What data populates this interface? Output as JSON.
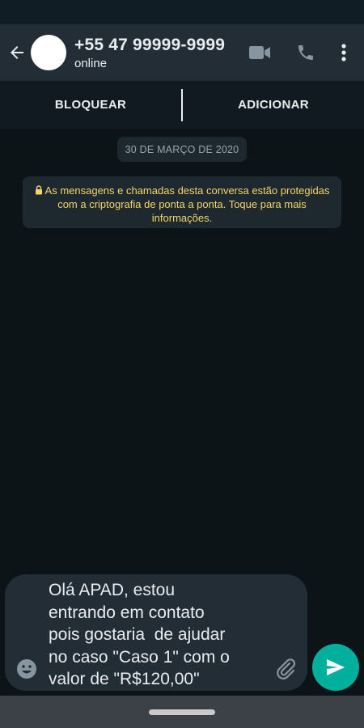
{
  "header": {
    "contact_name": "+55  47 99999-9999",
    "contact_status": "online",
    "icons": [
      "back-arrow-icon",
      "video-call-icon",
      "phone-icon",
      "more-vert-icon"
    ]
  },
  "actions": {
    "block_label": "BLOQUEAR",
    "add_label": "ADICIONAR"
  },
  "chat": {
    "date_label": "30 DE MARÇO DE 2020",
    "encryption_notice": "As mensagens e chamadas desta conversa estão protegidas com a criptografia de ponta a ponta. Toque para mais informações."
  },
  "composer": {
    "text": "Olá APAD, estou\nentrando em contato\npois gostaria  de ajudar\nno caso \"Caso 1\" com o\nvalor de \"R$120,00\""
  },
  "colors": {
    "background": "#0d1418",
    "header": "#232d36",
    "notice_text": "#f7d46b",
    "send_button": "#00af9c"
  }
}
